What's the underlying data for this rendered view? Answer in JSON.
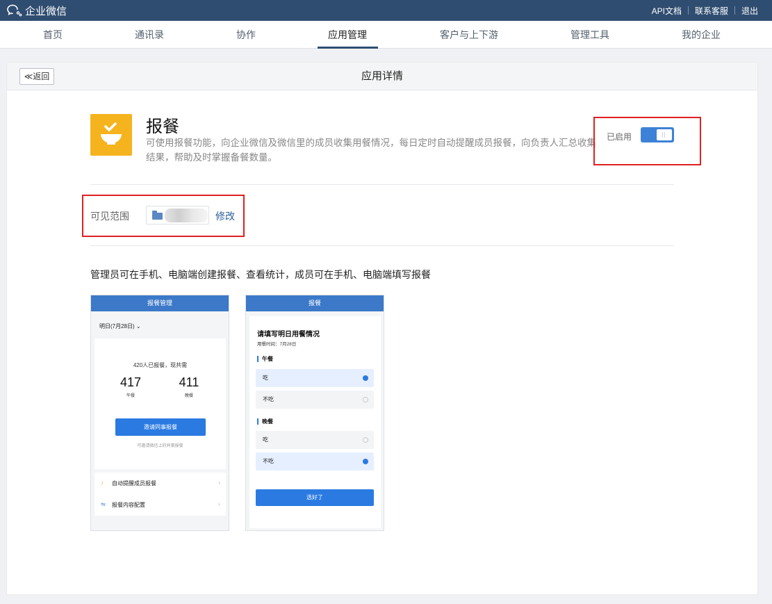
{
  "topbar": {
    "logo_text": "企业微信",
    "links": [
      "API文档",
      "联系客服",
      "退出"
    ]
  },
  "nav": {
    "tabs": [
      "首页",
      "通讯录",
      "协作",
      "应用管理",
      "客户与上下游",
      "管理工具",
      "我的企业"
    ],
    "active": "应用管理"
  },
  "card": {
    "back_label": "≪返回",
    "title": "应用详情"
  },
  "app": {
    "name": "报餐",
    "description": "可使用报餐功能，向企业微信及微信里的成员收集用餐情况，每日定时自动提醒成员报餐，向负责人汇总收集结果，帮助及时掌握备餐数量。",
    "status_label": "已启用",
    "enabled": true,
    "icon": "meal-bowl-icon",
    "icon_color": "#f5b31e"
  },
  "scope": {
    "label": "可见范围",
    "edit_label": "修改"
  },
  "intro": "管理员可在手机、电脑端创建报餐、查看统计，成员可在手机、电脑端填写报餐",
  "preview_admin": {
    "bar_title": "报餐管理",
    "date": "明日(7月28日)",
    "summary": "420人已报餐，现共需",
    "lunch_count": "417",
    "lunch_label": "午餐",
    "dinner_count": "411",
    "dinner_label": "晚餐",
    "invite_button": "邀请同事报餐",
    "invite_hint": "可邀请微信上的同事报餐",
    "menu": [
      "自动提醒成员报餐",
      "报餐内容配置"
    ]
  },
  "preview_member": {
    "bar_title": "报餐",
    "title": "请填写明日用餐情况",
    "meal_time": "用餐时间：7月28日",
    "lunch_section": "午餐",
    "dinner_section": "晚餐",
    "option_eat": "吃",
    "option_not_eat": "不吃",
    "lunch_choice": "吃",
    "dinner_choice": "不吃",
    "submit_button": "选好了"
  },
  "colors": {
    "topbar": "#2f4d70",
    "accent": "#3d82d6",
    "highlight": "#e02020"
  }
}
